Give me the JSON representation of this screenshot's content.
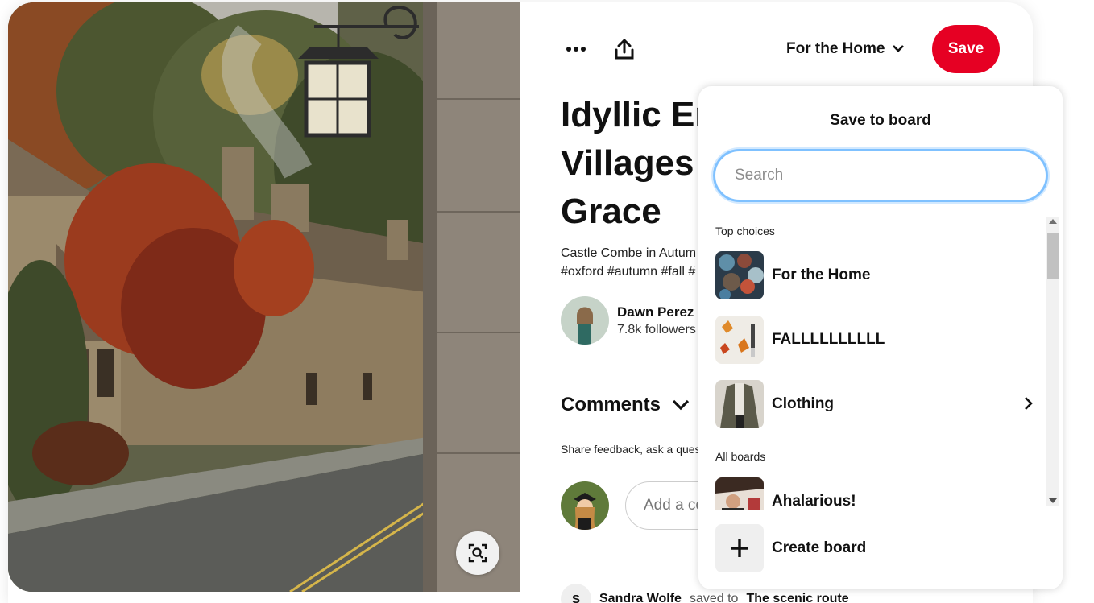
{
  "header": {
    "board_selector": "For the Home",
    "save_label": "Save"
  },
  "pin": {
    "title": "Idyllic En Villages Grace",
    "title_lines": [
      "Idyllic En",
      "Villages",
      "Grace"
    ],
    "description_lines": [
      "Castle Combe in Autum",
      "#oxford #autumn #fall #"
    ],
    "creator": {
      "name": "Dawn Perez",
      "followers": "7.8k followers"
    }
  },
  "comments": {
    "heading": "Comments",
    "hint": "Share feedback, ask a quest",
    "input_placeholder": "Add a co",
    "activity": {
      "avatar_initial": "S",
      "user": "Sandra Wolfe",
      "text": "saved to",
      "board": "The scenic route"
    }
  },
  "popover": {
    "title": "Save to board",
    "search_placeholder": "Search",
    "top_choices_label": "Top choices",
    "all_boards_label": "All boards",
    "top_choices": [
      {
        "name": "For the Home",
        "icon": "mugs-thumbnail"
      },
      {
        "name": "FALLLLLLLLLL",
        "icon": "leaves-thumbnail"
      },
      {
        "name": "Clothing",
        "icon": "cardigan-thumbnail",
        "has_chevron": true
      }
    ],
    "all_boards": [
      {
        "name": "Ahalarious!",
        "icon": "person-thumbnail"
      }
    ],
    "create_label": "Create board"
  },
  "colors": {
    "save_red": "#e60023",
    "focus_blue": "#7fc1ff"
  }
}
